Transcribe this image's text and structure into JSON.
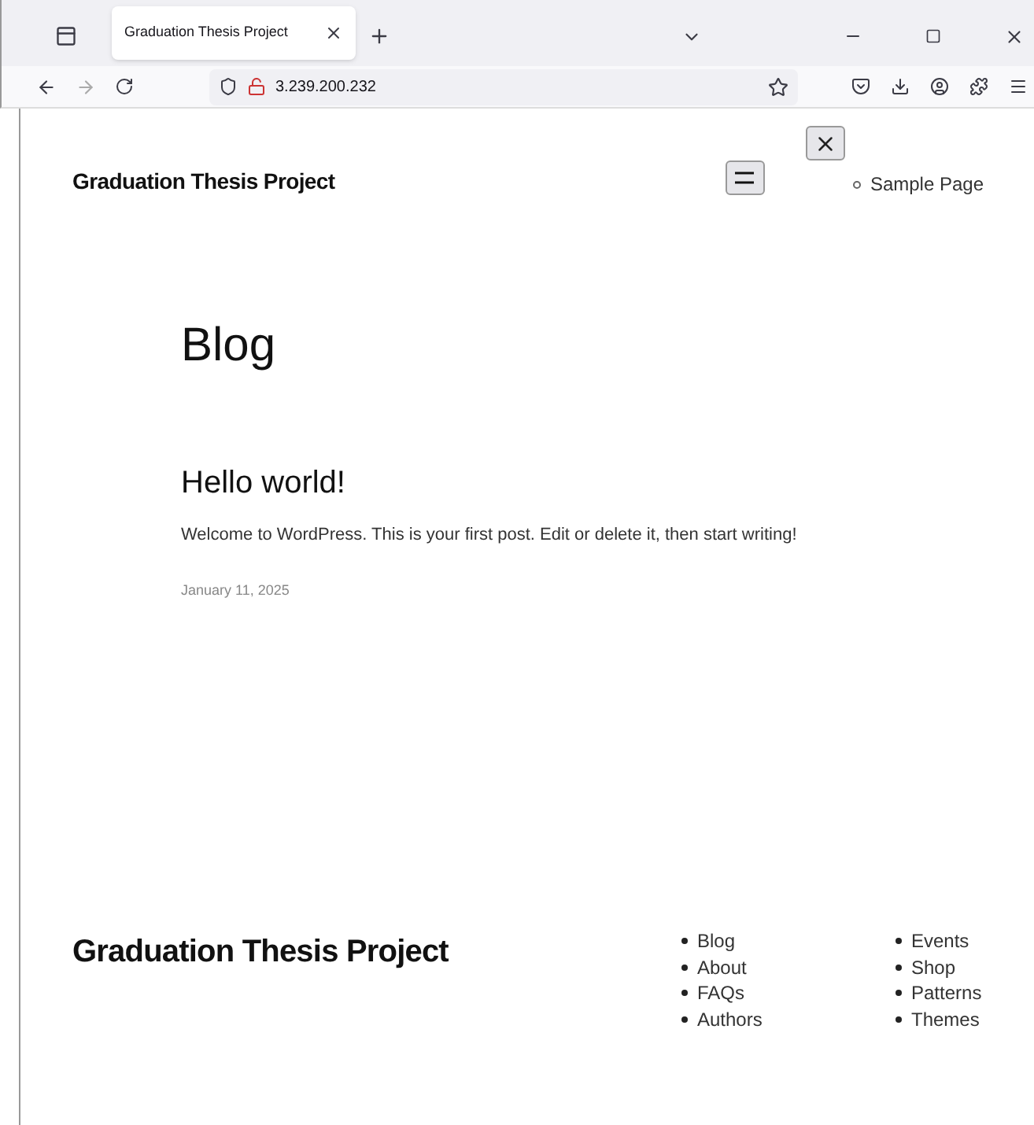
{
  "browser": {
    "tab_title": "Graduation Thesis Project",
    "url": "3.239.200.232"
  },
  "header": {
    "site_title": "Graduation Thesis Project",
    "nav_items": [
      "Sample Page"
    ]
  },
  "main": {
    "heading": "Blog",
    "posts": [
      {
        "title": "Hello world!",
        "excerpt": "Welcome to WordPress. This is your first post. Edit or delete it, then start writing!",
        "date": "January 11, 2025"
      }
    ]
  },
  "footer": {
    "site_title": "Graduation Thesis Project",
    "columns": [
      [
        "Blog",
        "About",
        "FAQs",
        "Authors"
      ],
      [
        "Events",
        "Shop",
        "Patterns",
        "Themes"
      ]
    ]
  }
}
